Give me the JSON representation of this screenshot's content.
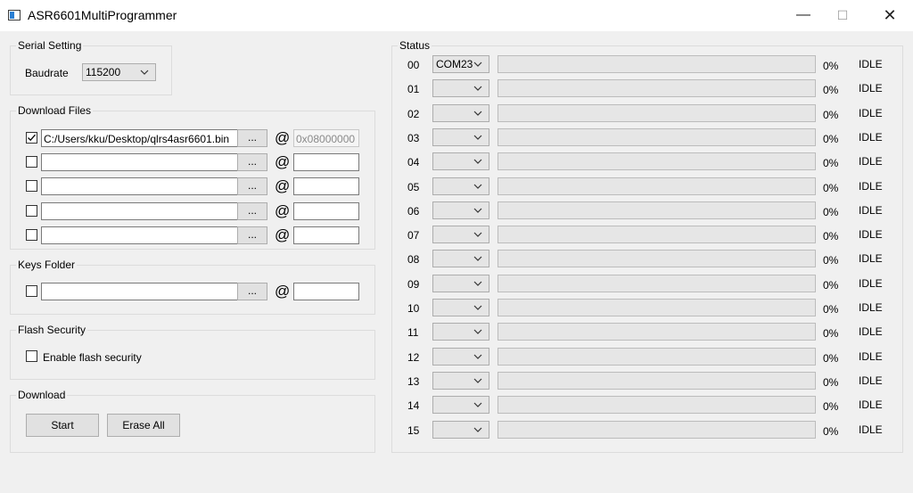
{
  "window": {
    "title": "ASR6601MultiProgrammer",
    "minimize_glyph": "—",
    "maximize_glyph": "☐",
    "close_glyph": "✕"
  },
  "serial": {
    "group_label": "Serial Setting",
    "baudrate_label": "Baudrate",
    "baudrate_value": "115200"
  },
  "download_files": {
    "group_label": "Download Files",
    "browse_label": "...",
    "at_label": "@",
    "rows": [
      {
        "checked": true,
        "path": "C:/Users/kku/Desktop/qlrs4asr6601.bin",
        "address": "0x08000000"
      },
      {
        "checked": false,
        "path": "",
        "address": ""
      },
      {
        "checked": false,
        "path": "",
        "address": ""
      },
      {
        "checked": false,
        "path": "",
        "address": ""
      },
      {
        "checked": false,
        "path": "",
        "address": ""
      }
    ]
  },
  "keys_folder": {
    "group_label": "Keys Folder",
    "browse_label": "...",
    "at_label": "@",
    "checked": false,
    "path": "",
    "address": ""
  },
  "flash_security": {
    "group_label": "Flash Security",
    "enable_label": "Enable flash security",
    "checked": false
  },
  "download": {
    "group_label": "Download",
    "start_label": "Start",
    "erase_label": "Erase All"
  },
  "status": {
    "group_label": "Status",
    "progress_color": "#06b025",
    "rows": [
      {
        "index": "00",
        "port": "COM23",
        "progress": 0,
        "percent": "0%",
        "state": "IDLE"
      },
      {
        "index": "01",
        "port": "",
        "progress": 0,
        "percent": "0%",
        "state": "IDLE"
      },
      {
        "index": "02",
        "port": "",
        "progress": 0,
        "percent": "0%",
        "state": "IDLE"
      },
      {
        "index": "03",
        "port": "",
        "progress": 0,
        "percent": "0%",
        "state": "IDLE"
      },
      {
        "index": "04",
        "port": "",
        "progress": 0,
        "percent": "0%",
        "state": "IDLE"
      },
      {
        "index": "05",
        "port": "",
        "progress": 0,
        "percent": "0%",
        "state": "IDLE"
      },
      {
        "index": "06",
        "port": "",
        "progress": 0,
        "percent": "0%",
        "state": "IDLE"
      },
      {
        "index": "07",
        "port": "",
        "progress": 0,
        "percent": "0%",
        "state": "IDLE"
      },
      {
        "index": "08",
        "port": "",
        "progress": 0,
        "percent": "0%",
        "state": "IDLE"
      },
      {
        "index": "09",
        "port": "",
        "progress": 0,
        "percent": "0%",
        "state": "IDLE"
      },
      {
        "index": "10",
        "port": "",
        "progress": 0,
        "percent": "0%",
        "state": "IDLE"
      },
      {
        "index": "11",
        "port": "",
        "progress": 0,
        "percent": "0%",
        "state": "IDLE"
      },
      {
        "index": "12",
        "port": "",
        "progress": 0,
        "percent": "0%",
        "state": "IDLE"
      },
      {
        "index": "13",
        "port": "",
        "progress": 0,
        "percent": "0%",
        "state": "IDLE"
      },
      {
        "index": "14",
        "port": "",
        "progress": 0,
        "percent": "0%",
        "state": "IDLE"
      },
      {
        "index": "15",
        "port": "",
        "progress": 0,
        "percent": "0%",
        "state": "IDLE"
      }
    ]
  }
}
